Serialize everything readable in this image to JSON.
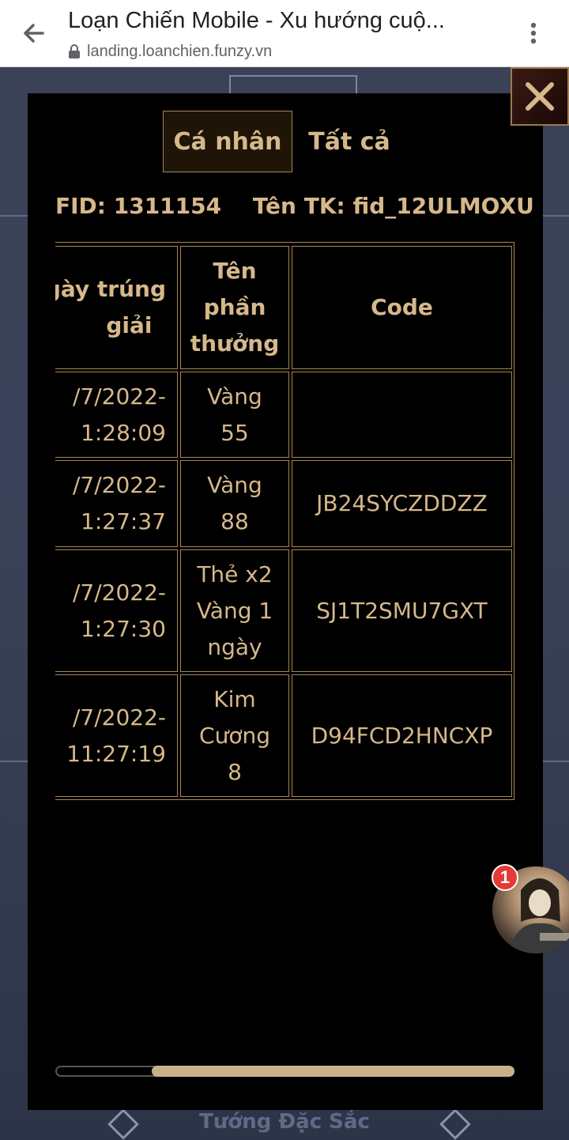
{
  "browser": {
    "title": "Loạn Chiến Mobile - Xu hướng cuộ...",
    "url": "landing.loanchien.funzy.vn"
  },
  "background": {
    "bottom_label": "Tướng Đặc Sắc"
  },
  "modal": {
    "tabs": [
      {
        "label": "Cá nhân",
        "active": true
      },
      {
        "label": "Tất cả",
        "active": false
      }
    ],
    "fid": "FID: 1311154",
    "account": "Tên TK: fid_12ULMOXU",
    "table": {
      "headers": [
        "Ngày trúng giải",
        "Tên phần thưởng",
        "Code"
      ],
      "header_lines": {
        "date": [
          "gày trúng",
          "giải"
        ],
        "prize": [
          "Tên",
          "phần",
          "thưởng"
        ],
        "code": [
          "Code"
        ]
      },
      "rows": [
        {
          "date_l1": "/7/2022-",
          "date_l2": "1:28:09",
          "prize_lines": [
            "Vàng",
            "55"
          ],
          "code": ""
        },
        {
          "date_l1": "/7/2022-",
          "date_l2": "1:27:37",
          "prize_lines": [
            "Vàng",
            "88"
          ],
          "code": "JB24SYCZDDZZ"
        },
        {
          "date_l1": "/7/2022-",
          "date_l2": "1:27:30",
          "prize_lines": [
            "Thẻ x2",
            "Vàng 1",
            "ngày"
          ],
          "code": "SJ1T2SMU7GXT"
        },
        {
          "date_l1": "/7/2022-",
          "date_l2": "11:27:19",
          "prize_lines": [
            "Kim",
            "Cương",
            "8"
          ],
          "code": "D94FCD2HNCXP"
        }
      ]
    }
  },
  "chat_head": {
    "badge_count": "1"
  },
  "colors": {
    "accent": "#d6b88a",
    "border": "#a58657",
    "modal_bg": "#000000"
  }
}
